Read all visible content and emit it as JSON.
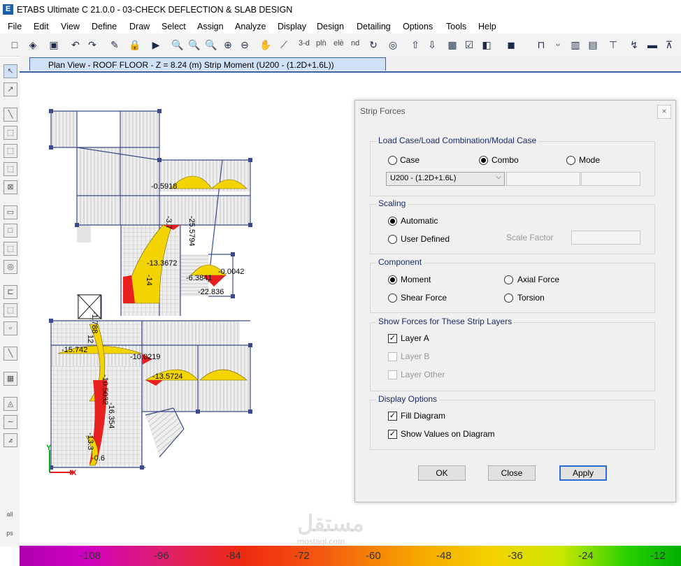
{
  "app": {
    "logo_letter": "E",
    "title": "ETABS Ultimate C 21.0.0 - 03-CHECK DEFLECTION & SLAB DESIGN"
  },
  "menu": [
    "File",
    "Edit",
    "View",
    "Define",
    "Draw",
    "Select",
    "Assign",
    "Analyze",
    "Display",
    "Design",
    "Detailing",
    "Options",
    "Tools",
    "Help"
  ],
  "toolbar": {
    "view3d": "3-d",
    "plan": "plǹ",
    "elev": "elѐ",
    "nd": "nd"
  },
  "tab": {
    "label": "Plan View - ROOF FLOOR - Z = 8.24 (m)   Strip Moment  (U200 - (1.2D+1.6L))"
  },
  "canvas": {
    "values": [
      "-0.5918",
      "-3.7",
      "-25.5794",
      "-13.3672",
      "-14",
      "-6.3841",
      "-0.0042",
      "-22.836",
      "-1.788",
      "-15.742",
      "12",
      "-10.0219",
      "-10.5032",
      "-13.5724",
      "-16.354",
      "-13.3",
      "-0.6"
    ],
    "axis_x": "X",
    "axis_y": "Y"
  },
  "dialog": {
    "title": "Strip Forces",
    "close_glyph": "×",
    "load_group": {
      "label": "Load Case/Load Combination/Modal Case",
      "options": [
        "Case",
        "Combo",
        "Mode"
      ],
      "selected": "Combo",
      "combo_value": "U200 - (1.2D+1.6L)"
    },
    "scaling": {
      "label": "Scaling",
      "automatic": "Automatic",
      "user_defined": "User Defined",
      "scale_factor": "Scale Factor"
    },
    "component": {
      "label": "Component",
      "moment": "Moment",
      "axial": "Axial Force",
      "shear": "Shear Force",
      "torsion": "Torsion"
    },
    "layers": {
      "label": "Show Forces for These Strip Layers",
      "a": "Layer A",
      "b": "Layer B",
      "other": "Layer Other"
    },
    "display": {
      "label": "Display Options",
      "fill": "Fill Diagram",
      "values": "Show Values on Diagram"
    },
    "buttons": {
      "ok": "OK",
      "close": "Close",
      "apply": "Apply"
    }
  },
  "colorbar": {
    "labels": [
      "-108",
      "-96",
      "-84",
      "-72",
      "-60",
      "-48",
      "-36",
      "-24",
      "-12"
    ]
  },
  "watermark": {
    "text": "مستقل",
    "sub": "mostaql.com"
  }
}
